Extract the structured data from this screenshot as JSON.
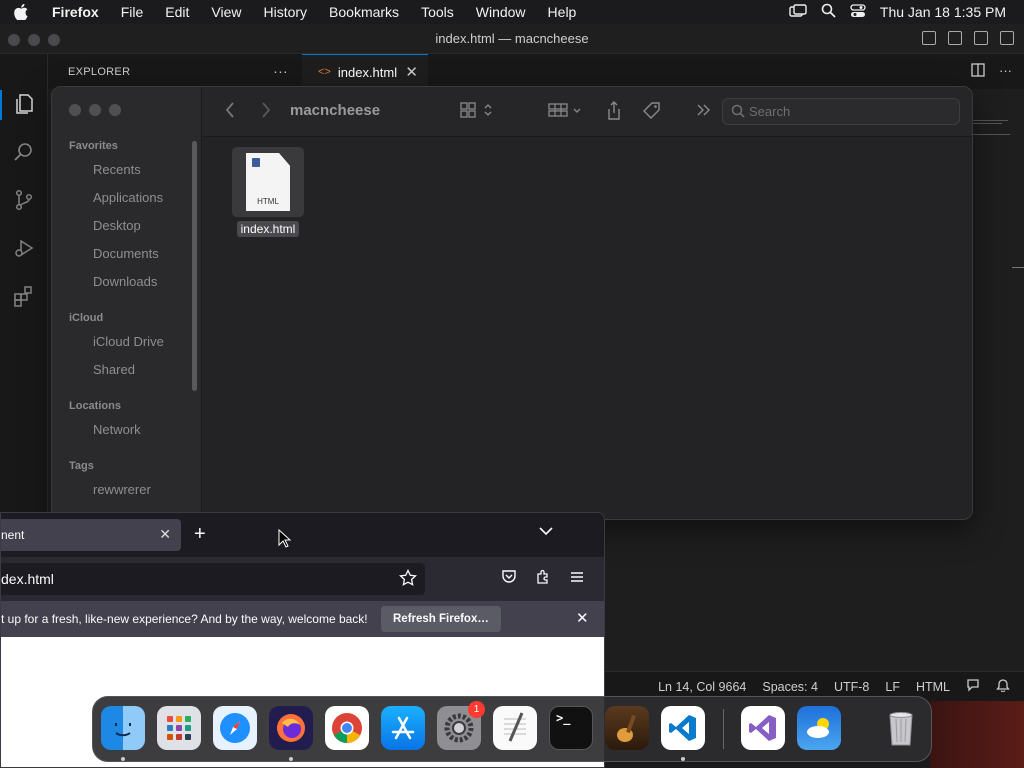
{
  "menubar": {
    "app_name": "Firefox",
    "items": [
      "File",
      "Edit",
      "View",
      "History",
      "Bookmarks",
      "Tools",
      "Window",
      "Help"
    ],
    "clock": "Thu Jan 18  1:35 PM"
  },
  "vscode": {
    "window_title": "index.html — macncheese",
    "explorer_label": "EXPLORER",
    "tab_label": "index.html",
    "status": {
      "position": "Ln 14, Col 9664",
      "spaces": "Spaces: 4",
      "encoding": "UTF-8",
      "eol": "LF",
      "language": "HTML"
    }
  },
  "finder": {
    "folder_title": "macncheese",
    "search_placeholder": "Search",
    "sidebar": {
      "favorites_header": "Favorites",
      "favorites": [
        "Recents",
        "Applications",
        "Desktop",
        "Documents",
        "Downloads"
      ],
      "icloud_header": "iCloud",
      "icloud": [
        "iCloud Drive",
        "Shared"
      ],
      "locations_header": "Locations",
      "locations": [
        "Network"
      ],
      "tags_header": "Tags",
      "tags": [
        "rewwrerer"
      ]
    },
    "file": {
      "name": "index.html",
      "type_label": "HTML"
    }
  },
  "firefox": {
    "tab_title": "nent",
    "url_text": "dex.html",
    "notice_text": "t up for a fresh, like-new experience? And by the way, welcome back!",
    "refresh_button": "Refresh Firefox…"
  },
  "dock": {
    "apps": [
      "Finder",
      "Launchpad",
      "Safari",
      "Firefox",
      "Chrome",
      "App Store",
      "System Settings",
      "TextEdit",
      "Terminal",
      "GarageBand",
      "VS Code",
      "Visual Studio",
      "Weather",
      "Trash"
    ],
    "settings_badge": "1"
  }
}
